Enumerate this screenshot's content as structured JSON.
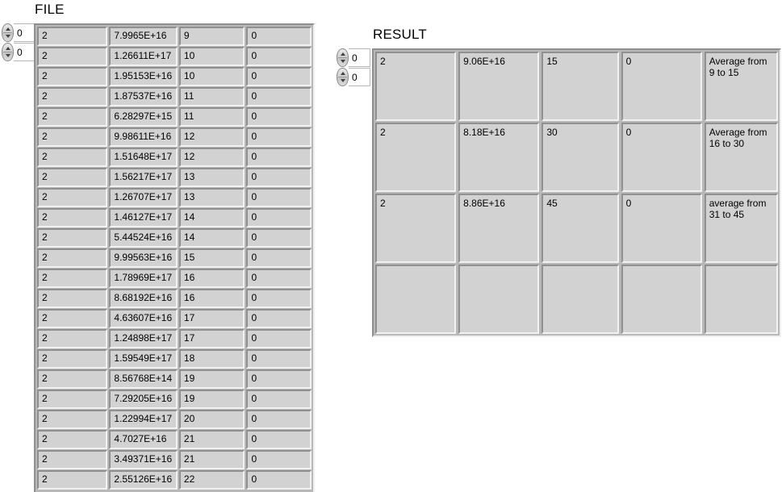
{
  "file_panel": {
    "title": "FILE",
    "index_controls": [
      {
        "name": "row-index",
        "value": "0",
        "up_icon": "arrow-up-icon",
        "down_icon": "arrow-down-icon"
      },
      {
        "name": "col-index",
        "value": "0",
        "up_icon": "arrow-up-icon",
        "down_icon": "arrow-down-icon"
      }
    ],
    "rows": [
      [
        "2",
        "7.9965E+16",
        "9",
        "0"
      ],
      [
        "2",
        "1.26611E+17",
        "10",
        "0"
      ],
      [
        "2",
        "1.95153E+16",
        "10",
        "0"
      ],
      [
        "2",
        "1.87537E+16",
        "11",
        "0"
      ],
      [
        "2",
        "6.28297E+15",
        "11",
        "0"
      ],
      [
        "2",
        "9.98611E+16",
        "12",
        "0"
      ],
      [
        "2",
        "1.51648E+17",
        "12",
        "0"
      ],
      [
        "2",
        "1.56217E+17",
        "13",
        "0"
      ],
      [
        "2",
        "1.26707E+17",
        "13",
        "0"
      ],
      [
        "2",
        "1.46127E+17",
        "14",
        "0"
      ],
      [
        "2",
        "5.44524E+16",
        "14",
        "0"
      ],
      [
        "2",
        "9.99563E+16",
        "15",
        "0"
      ],
      [
        "2",
        "1.78969E+17",
        "16",
        "0"
      ],
      [
        "2",
        "8.68192E+16",
        "16",
        "0"
      ],
      [
        "2",
        "4.63607E+16",
        "17",
        "0"
      ],
      [
        "2",
        "1.24898E+17",
        "17",
        "0"
      ],
      [
        "2",
        "1.59549E+17",
        "18",
        "0"
      ],
      [
        "2",
        "8.56768E+14",
        "19",
        "0"
      ],
      [
        "2",
        "7.29205E+16",
        "19",
        "0"
      ],
      [
        "2",
        "1.22994E+17",
        "20",
        "0"
      ],
      [
        "2",
        "4.7027E+16",
        "21",
        "0"
      ],
      [
        "2",
        "3.49371E+16",
        "21",
        "0"
      ],
      [
        "2",
        "2.55126E+16",
        "22",
        "0"
      ]
    ]
  },
  "result_panel": {
    "title": "RESULT",
    "index_controls": [
      {
        "name": "row-index",
        "value": "0",
        "up_icon": "arrow-up-icon",
        "down_icon": "arrow-down-icon"
      },
      {
        "name": "col-index",
        "value": "0",
        "up_icon": "arrow-up-icon",
        "down_icon": "arrow-down-icon"
      }
    ],
    "rows": [
      [
        "2",
        "9.06E+16",
        "15",
        "0",
        "Average from 9 to 15"
      ],
      [
        "2",
        "8.18E+16",
        "30",
        "0",
        "Average from 16 to 30"
      ],
      [
        "2",
        "8.86E+16",
        "45",
        "0",
        "average from 31 to 45"
      ],
      [
        "",
        "",
        "",
        "",
        ""
      ]
    ]
  },
  "colors": {
    "background": "#ffffff",
    "cell_fill": "#d2d2d2",
    "frame_fill": "#b8b8b8",
    "border_dark": "#909090",
    "border_light": "#f2f2f2",
    "text": "#000000"
  }
}
